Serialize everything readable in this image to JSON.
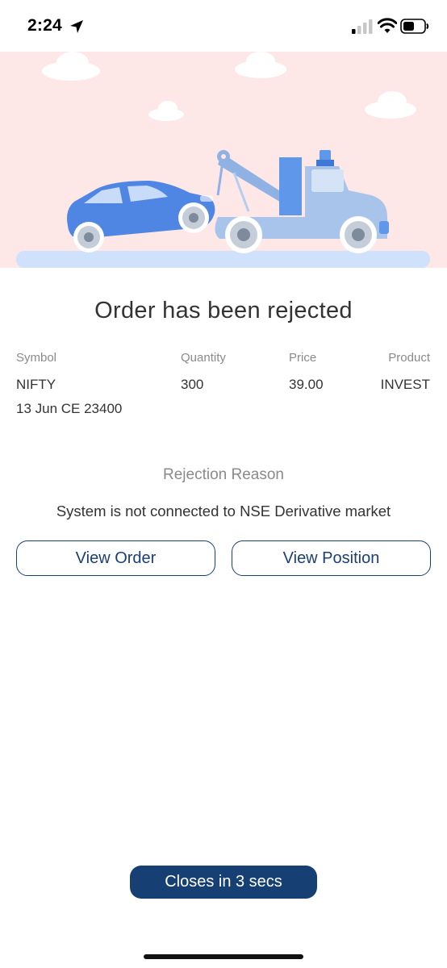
{
  "status_bar": {
    "time": "2:24",
    "icons": [
      "location-arrow-icon",
      "cellular-signal-icon",
      "wifi-icon",
      "battery-icon"
    ]
  },
  "illustration": {
    "name": "tow-truck-illustration",
    "colors": {
      "background": "#fde8e7",
      "car": "#4f86e3",
      "truck": "#a9c4ea",
      "road": "#cfe1fb",
      "clouds": "#ffffff"
    }
  },
  "order": {
    "title": "Order has been rejected",
    "labels": {
      "symbol": "Symbol",
      "quantity": "Quantity",
      "price": "Price",
      "product": "Product"
    },
    "values": {
      "symbol_line1": "NIFTY",
      "symbol_line2": "13 Jun CE 23400",
      "quantity": "300",
      "price": "39.00",
      "product": "INVEST"
    }
  },
  "rejection": {
    "label": "Rejection Reason",
    "reason": "System is not connected to NSE Derivative market"
  },
  "actions": {
    "view_order": "View Order",
    "view_position": "View Position",
    "close_timer": "Closes in 3 secs"
  },
  "colors": {
    "primary": "#163f73",
    "accent_border": "#1b3f74",
    "muted_text": "#8a8a8a",
    "text": "#333333"
  }
}
